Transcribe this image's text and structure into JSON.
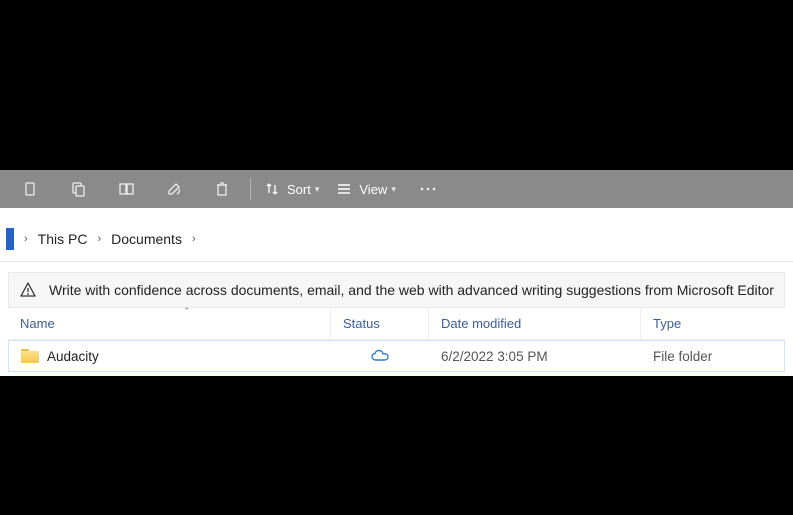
{
  "toolbar": {
    "sort_label": "Sort",
    "view_label": "View"
  },
  "breadcrumb": {
    "items": [
      "This PC",
      "Documents"
    ]
  },
  "banner": {
    "text": "Write with confidence across documents, email, and the web with advanced writing suggestions from Microsoft Editor"
  },
  "columns": {
    "name": "Name",
    "status": "Status",
    "date": "Date modified",
    "type": "Type"
  },
  "rows": [
    {
      "name": "Audacity",
      "status": "cloud",
      "date": "6/2/2022 3:05 PM",
      "type": "File folder"
    }
  ]
}
